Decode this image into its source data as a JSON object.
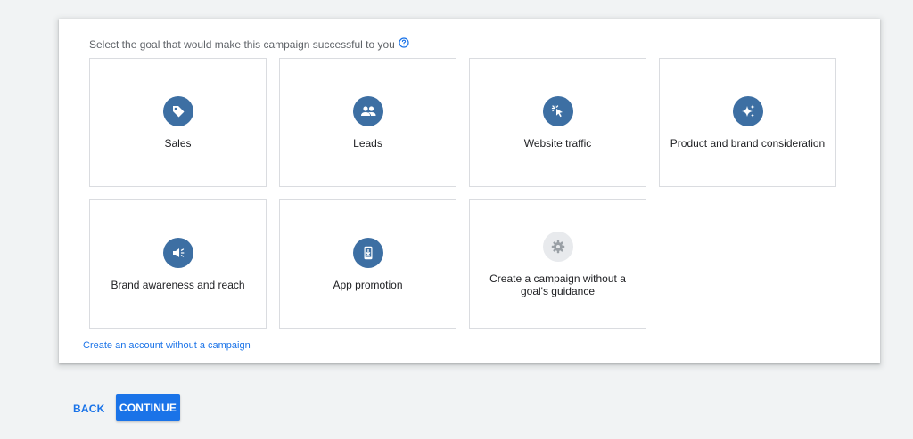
{
  "prompt": {
    "text": "Select the goal that would make this campaign successful to you",
    "help_icon": "help-circle-icon"
  },
  "goals": [
    {
      "label": "Sales",
      "icon": "tag-icon"
    },
    {
      "label": "Leads",
      "icon": "people-icon"
    },
    {
      "label": "Website traffic",
      "icon": "cursor-click-icon"
    },
    {
      "label": "Product and brand consideration",
      "icon": "sparkle-icon"
    },
    {
      "label": "Brand awareness and reach",
      "icon": "megaphone-icon"
    },
    {
      "label": "App promotion",
      "icon": "phone-download-icon"
    },
    {
      "label": "Create a campaign without a goal's guidance",
      "icon": "gear-icon"
    }
  ],
  "footer": {
    "link": "Create an account without a campaign"
  },
  "actions": {
    "back_label": "BACK",
    "continue_label": "CONTINUE"
  },
  "colors": {
    "accent": "#1a73e8",
    "icon_bg": "#3d6fa3",
    "icon_bg_muted": "#e8eaed",
    "page_bg": "#f1f3f4"
  }
}
